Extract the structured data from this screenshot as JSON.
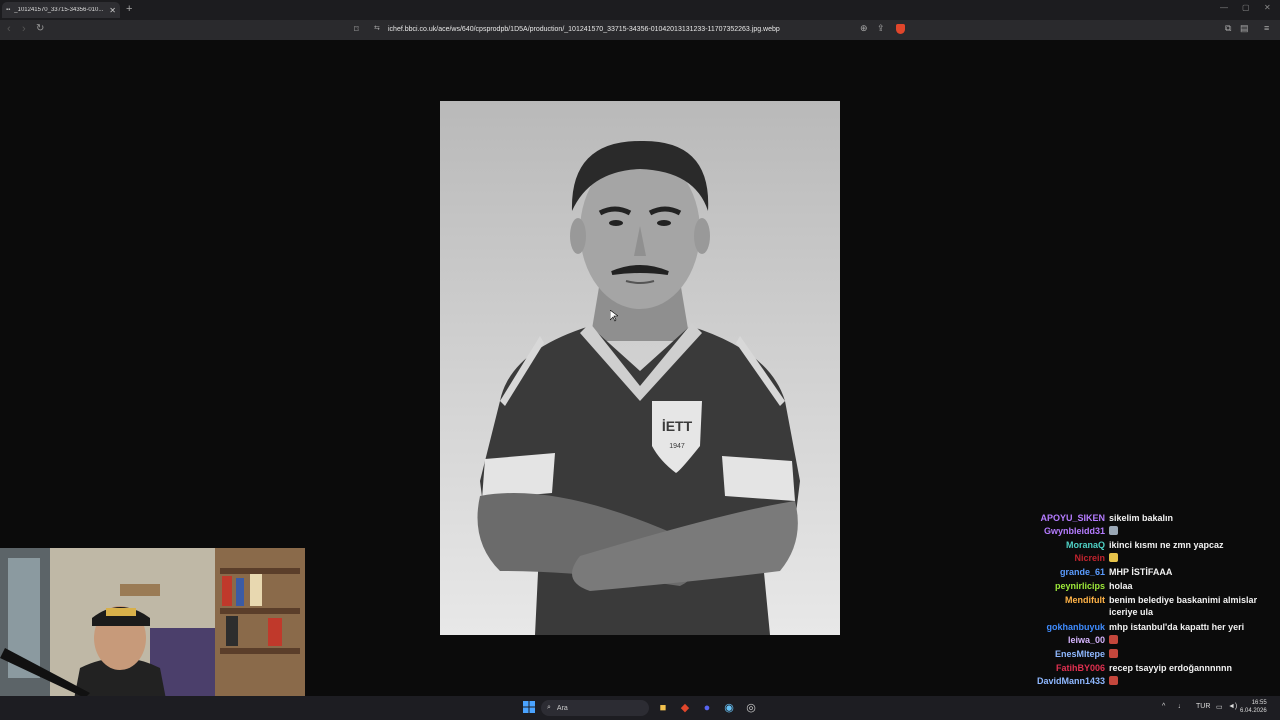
{
  "browser": {
    "tab_title": "_101241570_33715-34356-010...",
    "tab_favicon": "image-icon",
    "url": "ichef.bbci.co.uk/ace/ws/640/cpsprodpb/1D5A/production/_101241570_33715-34356-01042013131233-11707352263.jpg.webp"
  },
  "photo": {
    "description_alt": "",
    "badge_text": "İETT",
    "badge_year": "1947"
  },
  "chat": {
    "messages": [
      {
        "user": "APOYU_SIKEN",
        "color": "#b57cff",
        "text": "sikelim bakalın"
      },
      {
        "user": "Gwynbleidd31",
        "color": "#b57cff",
        "text": "",
        "emote": "#9aa7b5"
      },
      {
        "user": "MoranaQ",
        "color": "#4fd1c5",
        "text": "ikinci kısmı ne zmn yapcaz"
      },
      {
        "user": "Nicrein",
        "color": "#c0232e",
        "text": "",
        "emote": "#e6c34a"
      },
      {
        "user": "grande_61",
        "color": "#5b9cff",
        "text": "MHP İSTİFAAA"
      },
      {
        "user": "peynirlicips",
        "color": "#9eea3a",
        "text": "holaa"
      },
      {
        "user": "Mendifult",
        "color": "#ffb347",
        "text": "benim belediye baskanimi almislar iceriye ula"
      },
      {
        "user": "gokhanbuyuk",
        "color": "#3f8cff",
        "text": "mhp istanbul'da kapattı her yeri"
      },
      {
        "user": "leiwa_00",
        "color": "#d7b6ff",
        "text": "",
        "emote": "#c4473c"
      },
      {
        "user": "EnesMltepe",
        "color": "#8fb8ff",
        "text": "",
        "emote": "#c4473c"
      },
      {
        "user": "FatihBY006",
        "color": "#e03050",
        "text": "recep tsayyip erdoğannnnnn"
      },
      {
        "user": "DavidMann1433",
        "color": "#8fb8ff",
        "text": "",
        "emote": "#c4473c"
      },
      {
        "user": "leiwa_00",
        "color": "#d7b6ff",
        "text": ""
      }
    ]
  },
  "taskbar": {
    "search_placeholder": "Ara",
    "lang": "TUR",
    "time": "16:55",
    "date": "6.04.2026"
  }
}
